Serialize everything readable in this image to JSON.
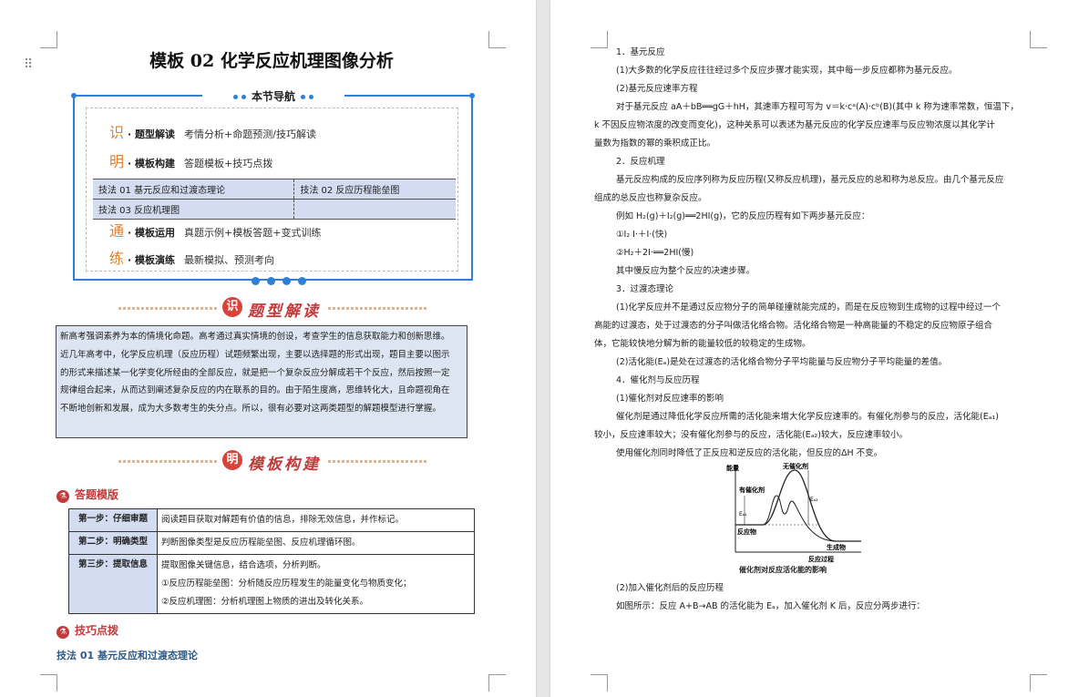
{
  "left": {
    "title": "模板 02  化学反应机理图像分析",
    "nav": {
      "heading": "本节导航",
      "rows": [
        {
          "char": "识",
          "label": "· 题型解读",
          "desc": "考情分析+命题预测/技巧解读"
        },
        {
          "char": "明",
          "label": "· 模板构建",
          "desc": "答题模板+技巧点拨"
        },
        {
          "char": "通",
          "label": "· 模板运用",
          "desc": "真题示例+模板答题+变式训练"
        },
        {
          "char": "练",
          "label": "· 模板演练",
          "desc": "最新模拟、预测考向"
        }
      ],
      "techniques": [
        [
          "技法 01   基元反应和过渡态理论",
          "技法 02   反应历程能垒图"
        ],
        [
          "技法 03   反应机理图",
          ""
        ]
      ]
    },
    "section1": {
      "badge": "识",
      "text": "题型解读"
    },
    "intro": [
      "新高考强调素养为本的情境化命题。高考通过真实情境的创设，考查学生的信息获取能力和创新思维。",
      "近几年高考中，化学反应机理（反应历程）试题频繁出现，主要以选择题的形式出现，题目主要以图示",
      "的形式来描述某一化学变化所经由的全部反应，就是把一个复杂反应分解成若干个反应，然后按照一定",
      "规律组合起来，从而达到阐述复杂反应的内在联系的目的。由于陌生度高，思维转化大，且命题视角在",
      "不断地创新和发展，成为大多数考生的失分点。所以，很有必要对这两类题型的解题模型进行掌握。"
    ],
    "section2": {
      "badge": "明",
      "text": "模板构建"
    },
    "answer_template": "答题模版",
    "steps": [
      {
        "key": "第一步：仔细审题",
        "lines": [
          "阅读题目获取对解题有价值的信息，排除无效信息，并作标记。"
        ]
      },
      {
        "key": "第二步：明确类型",
        "lines": [
          "判断图像类型是反应历程能垒图、反应机理循环图。"
        ]
      },
      {
        "key": "第三步：提取信息",
        "lines": [
          "提取图像关键信息，结合选项，分析判断。",
          "①反应历程能垒图：分析随反应历程发生的能量变化与物质变化；",
          "②反应机理图：分析机理图上物质的进出及转化关系。"
        ]
      }
    ],
    "tips_heading": "技巧点拨",
    "method_heading": "技法 01  基元反应和过渡态理论"
  },
  "right": {
    "lines": [
      "1．基元反应",
      "(1)大多数的化学反应往往经过多个反应步骤才能实现，其中每一步反应都称为基元反应。",
      "(2)基元反应速率方程",
      "对于基元反应 aA＋bB══gG＋hH，其速率方程可写为 v＝k·cᵃ(A)·cᵇ(B)(其中 k 称为速率常数，恒温下，",
      "k 不因反应物浓度的改变而变化)，这种关系可以表述为基元反应的化学反应速率与反应物浓度以其化学计",
      "量数为指数的幂的乘积成正比。",
      "2．反应机理",
      "基元反应构成的反应序列称为反应历程(又称反应机理)，基元反应的总和称为总反应。由几个基元反应",
      "组成的总反应也称复杂反应。",
      "例如 H₂(g)＋I₂(g)══2HI(g)，它的反应历程有如下两步基元反应：",
      "①I₂    I·＋I·(快)",
      "②H₂＋2I·══2HI(慢)",
      "其中慢反应为整个反应的决速步骤。",
      "3．过渡态理论",
      "(1)化学反应并不是通过反应物分子的简单碰撞就能完成的，而是在反应物到生成物的过程中经过一个",
      "高能的过渡态，处于过渡态的分子叫做活化络合物。活化络合物是一种高能量的不稳定的反应物原子组合",
      "体，它能较快地分解为新的能量较低的较稳定的生成物。",
      "(2)活化能(Eₐ)是处在过渡态的活化络合物分子平均能量与反应物分子平均能量的差值。",
      "4．催化剂与反应历程",
      "(1)催化剂对反应速率的影响",
      "催化剂是通过降低化学反应所需的活化能来增大化学反应速率的。有催化剂参与的反应，活化能(Eₐ₁)",
      "较小，反应速率较大；没有催化剂参与的反应，活化能(Eₐ₂)较大，反应速率较小。",
      "使用催化剂同时降低了正反应和逆反应的活化能，但反应的ΔH 不变。"
    ],
    "graph": {
      "y_axis": "能量",
      "no_catalyst": "无催化剂",
      "with_catalyst": "有催化剂",
      "ea1": "Eₐ₁",
      "ea2": "Eₐ₂",
      "reactant": "反应物",
      "product": "生成物",
      "x_axis": "反应过程",
      "caption": "催化剂对反应活化能的影响"
    },
    "after": [
      "(2)加入催化剂后的反应历程",
      "如图所示：反应 A+B→AB 的活化能为 Eₐ，加入催化剂 K 后，反应分两步进行："
    ]
  }
}
